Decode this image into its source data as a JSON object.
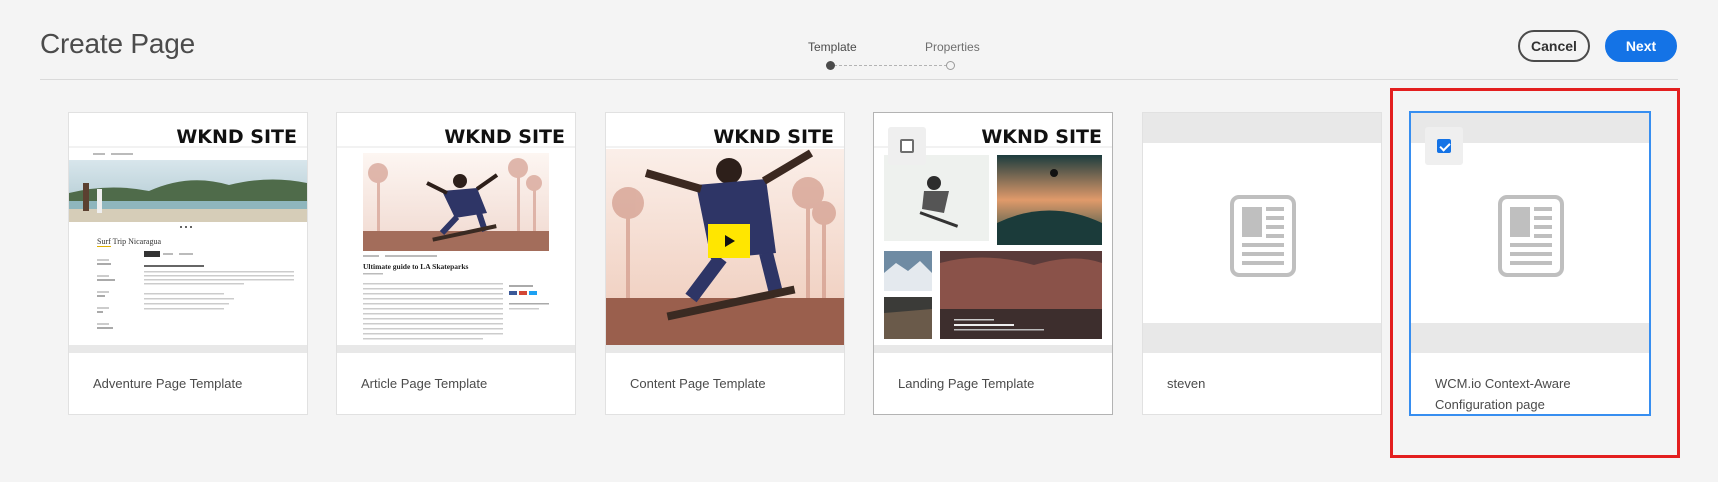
{
  "header": {
    "title": "Create Page",
    "steps": [
      {
        "label": "Template",
        "active": true
      },
      {
        "label": "Properties",
        "active": false
      }
    ],
    "cancel_label": "Cancel",
    "next_label": "Next"
  },
  "wknd_logo_text": "WKND SITE",
  "templates": [
    {
      "label": "Adventure Page Template",
      "thumb": "wknd-adventure",
      "selected": false
    },
    {
      "label": "Article Page Template",
      "thumb": "wknd-article",
      "selected": false
    },
    {
      "label": "Content Page Template",
      "thumb": "wknd-content",
      "selected": false
    },
    {
      "label": "Landing Page Template",
      "thumb": "wknd-landing",
      "selected": false
    },
    {
      "label": "steven",
      "thumb": "document-icon",
      "selected": false
    },
    {
      "label": "WCM.io Context-Aware Configuration page",
      "thumb": "document-icon",
      "selected": true
    }
  ],
  "thumb_text": {
    "adventure_title": "Surf Trip Nicaragua",
    "article_title": "Ultimate guide to LA Skateparks"
  },
  "colors": {
    "accent": "#1473e6",
    "highlight_box": "#e31f1f",
    "background": "#f4f4f4"
  }
}
